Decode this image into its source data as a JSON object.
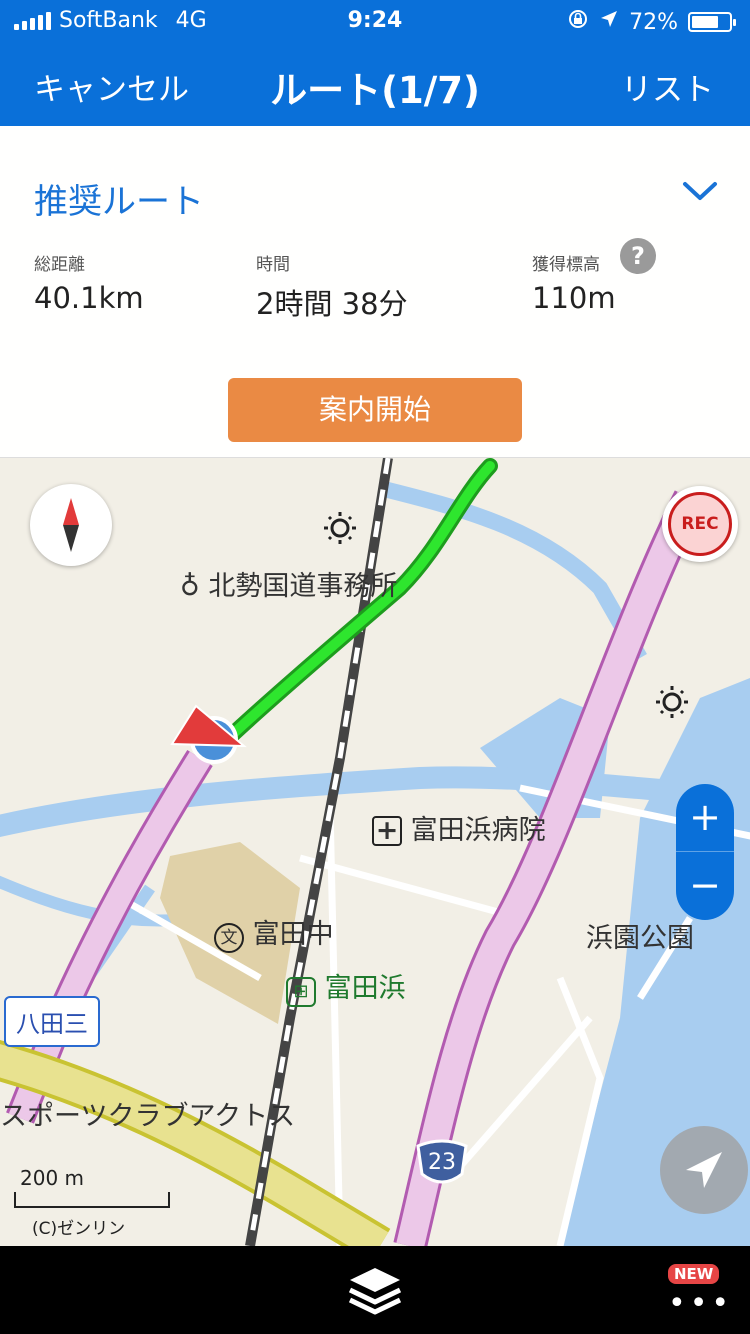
{
  "status_bar": {
    "carrier": "SoftBank",
    "network": "4G",
    "time": "9:24",
    "battery": "72%",
    "battery_level": 0.72
  },
  "header": {
    "cancel_label": "キャンセル",
    "title": "ルート(1/7)",
    "list_label": "リスト"
  },
  "route_panel": {
    "route_name": "推奨ルート",
    "stats": [
      {
        "label": "総距離",
        "value": "40.1km"
      },
      {
        "label": "時間",
        "value": "2時間 38分"
      },
      {
        "label": "獲得標高",
        "value": "110m"
      }
    ],
    "help_symbol": "?",
    "start_button": "案内開始"
  },
  "map": {
    "labels": {
      "office": "北勢国道事務所",
      "hospital": "富田浜病院",
      "school": "富田中",
      "station": "富田浜",
      "park": "浜園公園",
      "sports": "スポーツクラブアクトス",
      "callout": "八田三",
      "route_number": "23"
    },
    "rec_label": "REC",
    "zoom_in": "+",
    "zoom_out": "−",
    "scale_label": "200 m",
    "copyright": "(C)ゼンリン",
    "colors": {
      "water": "#a8cdf0",
      "highway": "#e8c8e4",
      "route": "#2ee62e",
      "accent": "#0a70d9",
      "start_button": "#ea8a44"
    }
  },
  "bottom_bar": {
    "new_badge": "NEW",
    "more_symbol": "•••"
  }
}
